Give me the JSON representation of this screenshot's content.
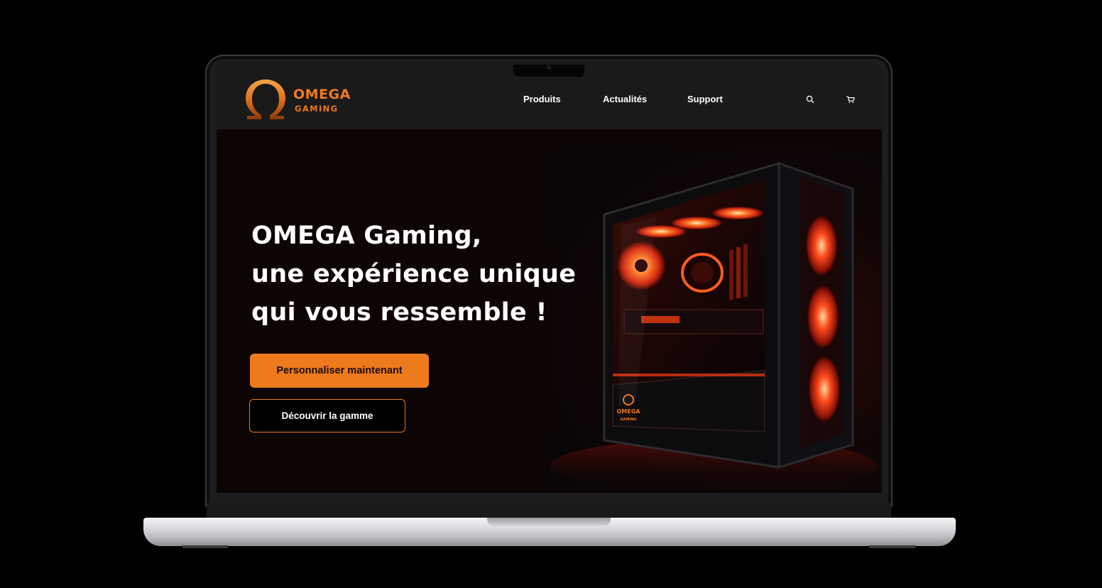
{
  "brand": {
    "name": "OMEGA",
    "tagline": "GAMING",
    "accent": "#ee7a1e"
  },
  "nav": {
    "links": [
      {
        "label": "Produits"
      },
      {
        "label": "Actualités"
      },
      {
        "label": "Support"
      }
    ],
    "icons": [
      "search-icon",
      "cart-icon"
    ]
  },
  "hero": {
    "headline": [
      "OMEGA Gaming,",
      "une expérience unique",
      "qui vous ressemble !"
    ],
    "primary_cta": "Personnaliser maintenant",
    "secondary_cta": "Découvrir la gamme",
    "case_badge": {
      "name": "OMEGA",
      "tagline": "GAMING"
    }
  },
  "colors": {
    "nav_bg": "#1a1a1a",
    "hero_bg": "#0d0504",
    "text": "#ffffff"
  }
}
